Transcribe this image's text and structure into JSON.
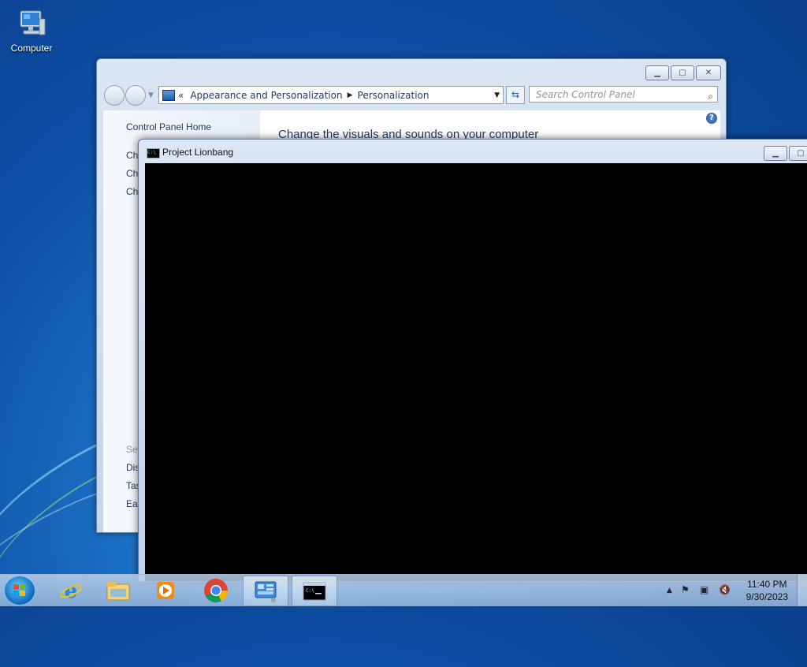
{
  "desktop": {
    "icons": [
      {
        "label": "Computer",
        "icon": "computer-icon"
      }
    ]
  },
  "control_panel": {
    "breadcrumb_prefix": "«",
    "breadcrumb": [
      "Appearance and Personalization",
      "Personalization"
    ],
    "search_placeholder": "Search Control Panel",
    "left_links": {
      "home": "Control Panel Home",
      "link1": "Ch",
      "link2": "Ch",
      "link3": "Ch",
      "see_also": "See",
      "bottom1": "Dis",
      "bottom2": "Tas",
      "bottom3": "Eas"
    },
    "heading": "Change the visuals and sounds on your computer",
    "help": "?"
  },
  "console": {
    "title": "Project Lionbang",
    "icon_text": "C:\\"
  },
  "taskbar": {
    "items": [
      {
        "name": "internet-explorer",
        "icon": "ie-icon",
        "active": false
      },
      {
        "name": "windows-explorer",
        "icon": "folder-icon",
        "active": false
      },
      {
        "name": "media-player",
        "icon": "media-player-icon",
        "active": false
      },
      {
        "name": "chrome",
        "icon": "chrome-icon",
        "active": false
      },
      {
        "name": "control-panel",
        "icon": "control-panel-icon",
        "active": true
      },
      {
        "name": "command-prompt",
        "icon": "cmd-icon",
        "active": true
      }
    ],
    "clock": {
      "time": "11:40 PM",
      "date": "9/30/2023"
    }
  },
  "colors": {
    "desktop_bg": "#1a6fc4",
    "console_bg": "#000000",
    "link": "#1e3a5f"
  }
}
